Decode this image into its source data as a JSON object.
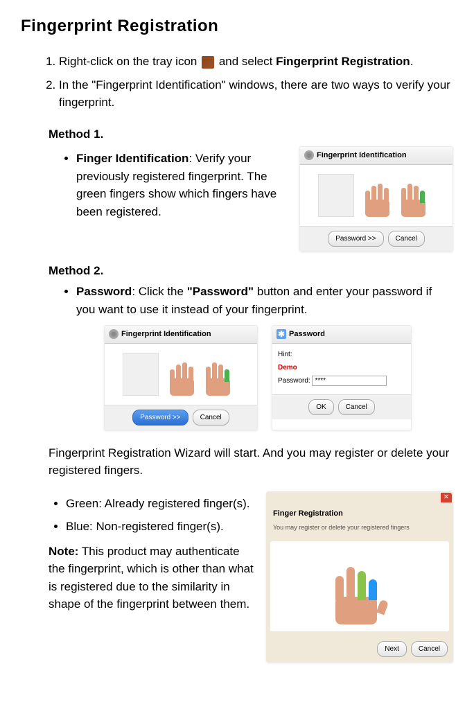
{
  "title": "Fingerprint Registration",
  "steps": {
    "s1_pre": "Right-click on the tray icon",
    "s1_post": "and select",
    "s1_bold": "Fingerprint Registration",
    "s2": "In the \"Fingerprint Identification\" windows, there are two ways to verify your fingerprint."
  },
  "method1": {
    "title": "Method 1.",
    "label": "Finger Identification",
    "desc": ": Verify your previously registered fingerprint. The green fingers show which fingers have been registered."
  },
  "method2": {
    "title": "Method 2.",
    "label": "Password",
    "desc_pre": ": Click the",
    "desc_bold": "\"Password\"",
    "desc_post": "button and enter your password if you want to use it instead of your fingerprint."
  },
  "dialog": {
    "fp_title": "Fingerprint Identification",
    "pwd_button": "Password >>",
    "cancel": "Cancel",
    "pwd_title": "Password",
    "hint_label": "Hint:",
    "hint_value": "Demo",
    "pwd_label": "Password:",
    "pwd_value": "****",
    "ok": "OK"
  },
  "wizard": {
    "intro": "Fingerprint Registration Wizard will start. And you may register or delete your registered fingers.",
    "green": "Green: Already registered finger(s).",
    "blue": "Blue: Non-registered finger(s).",
    "dialog_title": "Finger Registration",
    "dialog_sub": "You may register or delete your registered fingers",
    "next": "Next",
    "cancel": "Cancel"
  },
  "note": {
    "label": "Note:",
    "text": "This product may authenticate the fingerprint, which is other than what is registered due to the similarity in shape of the fingerprint between them."
  }
}
